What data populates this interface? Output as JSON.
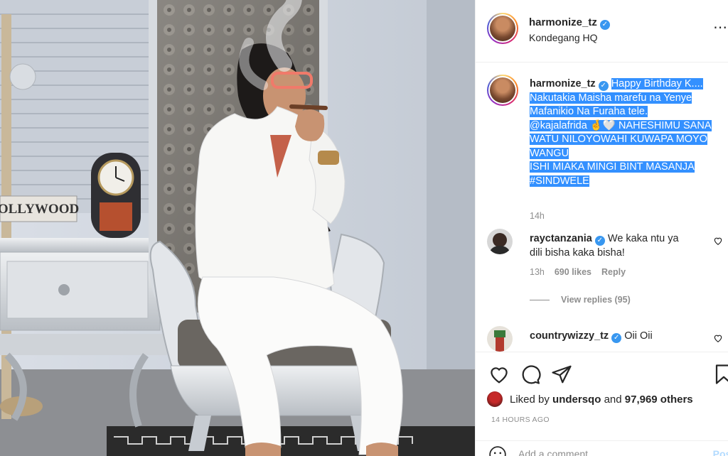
{
  "post": {
    "username": "harmonize_tz",
    "location": "Kondegang HQ",
    "more_icon": "more-options-icon"
  },
  "caption": {
    "username": "harmonize_tz",
    "lines": [
      "Happy Birthday K....",
      "Nakutakia Maisha marefu na Yenye",
      "Mafanikio Na Furaha tele.",
      "@kajalafrida 🤞🤍 NAHESHIMU SANA",
      "WATU NILOYOWAHI KUWAPA MOYO",
      "WANGU",
      "ISHI MIAKA MINGI BINT MASANJA",
      "#SINDWELE"
    ],
    "time": "14h"
  },
  "comments": [
    {
      "username": "rayctanzania",
      "text_line1": "We kaka ntu ya",
      "text_line2": "dili bisha kaka bisha!",
      "time": "13h",
      "likes": "690 likes",
      "reply": "Reply",
      "view_replies": "View replies (95)"
    },
    {
      "username": "countrywizzy_tz",
      "text_line1": "Oii Oii"
    }
  ],
  "photo_sign": "OLLYWOOD",
  "likes": {
    "prefix": "Liked by ",
    "user": "undersqo",
    "middle": " and ",
    "count": "97,969 others"
  },
  "time_ago": "14 HOURS AGO",
  "add_comment": {
    "placeholder": "Add a comment…",
    "post_label": "Post"
  },
  "colors": {
    "verified": "#3897f0",
    "selection": "#3390ff",
    "secondary_text": "#8e8e8e"
  }
}
